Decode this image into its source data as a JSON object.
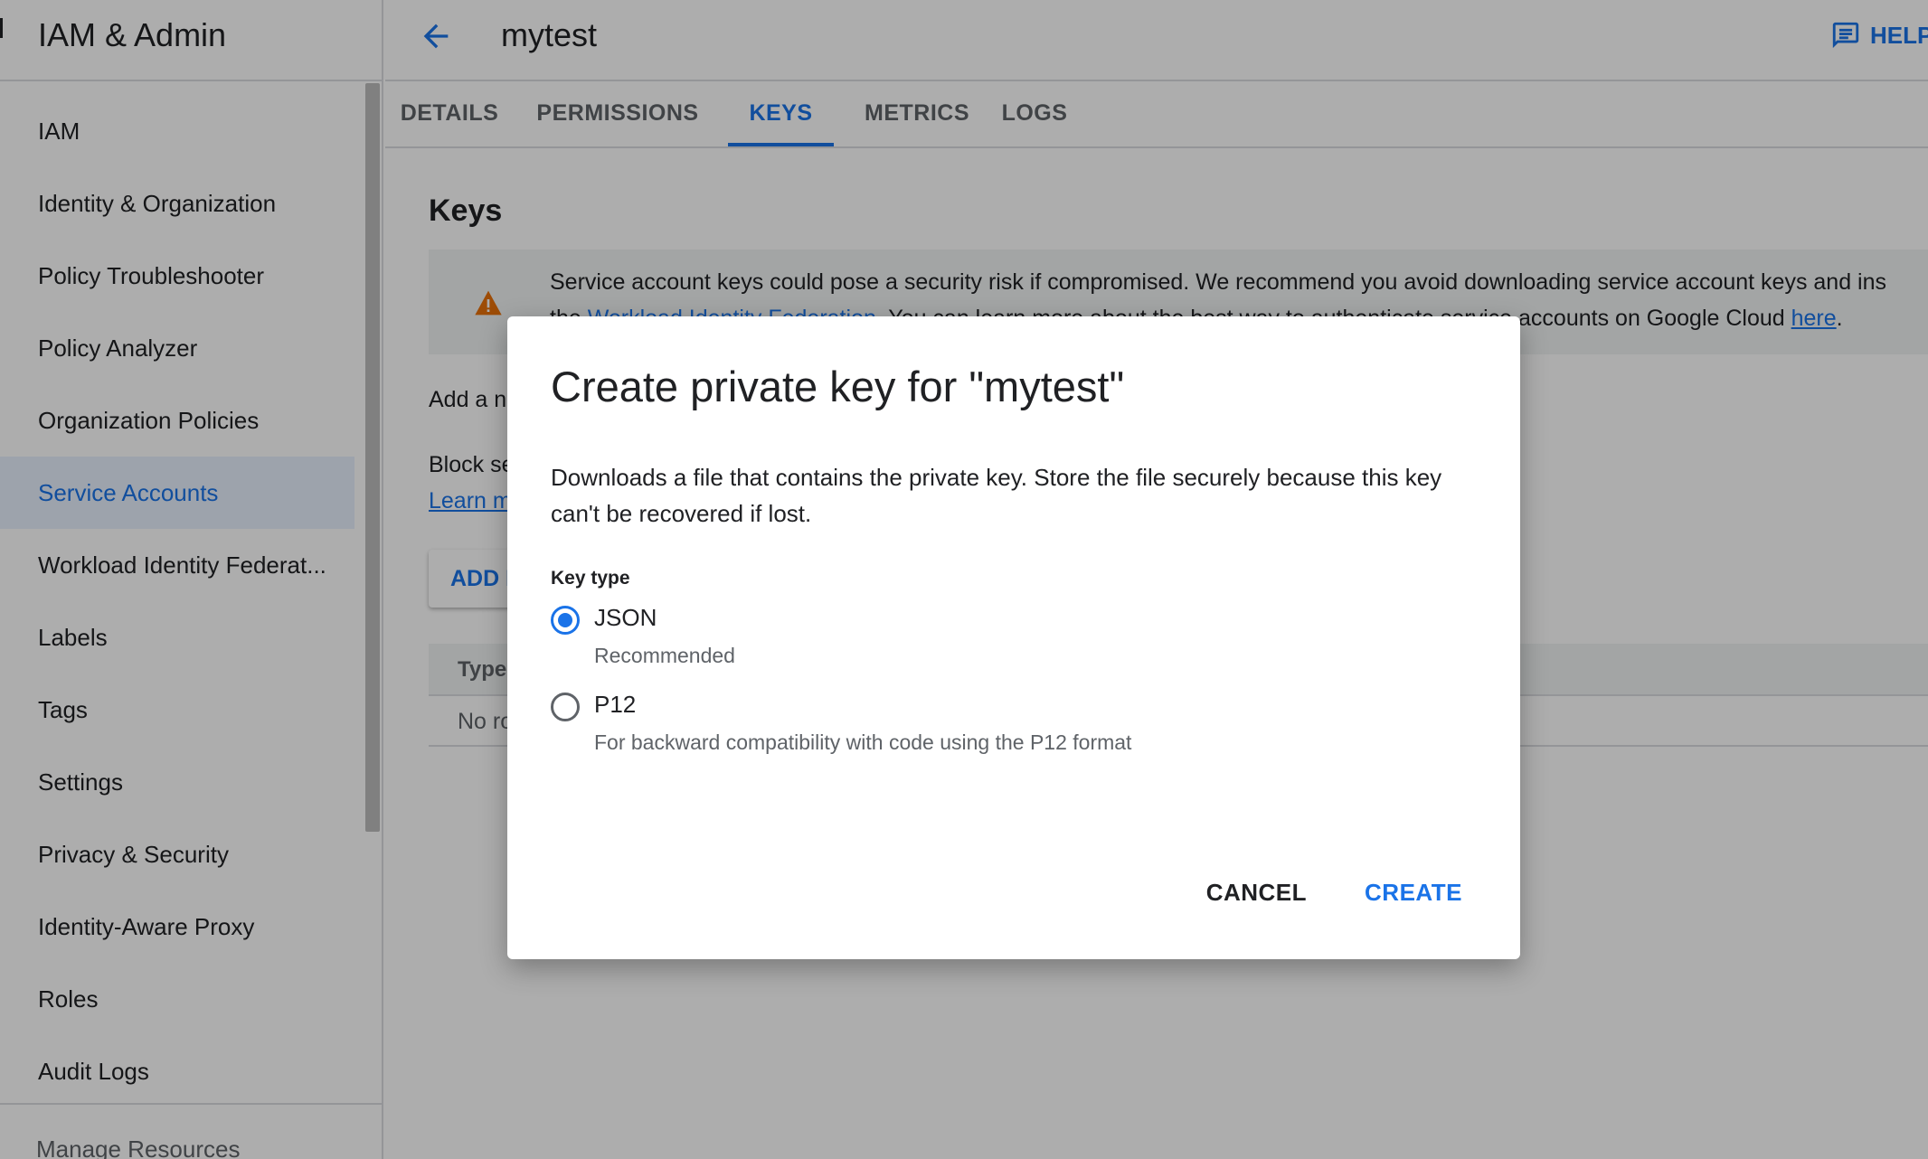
{
  "sidebar": {
    "title": "IAM & Admin",
    "items": [
      {
        "label": "IAM"
      },
      {
        "label": "Identity & Organization"
      },
      {
        "label": "Policy Troubleshooter"
      },
      {
        "label": "Policy Analyzer"
      },
      {
        "label": "Organization Policies"
      },
      {
        "label": "Service Accounts",
        "active": true
      },
      {
        "label": "Workload Identity Federat..."
      },
      {
        "label": "Labels"
      },
      {
        "label": "Tags"
      },
      {
        "label": "Settings"
      },
      {
        "label": "Privacy & Security"
      },
      {
        "label": "Identity-Aware Proxy"
      },
      {
        "label": "Roles"
      },
      {
        "label": "Audit Logs"
      }
    ],
    "footer": "Manage Resources"
  },
  "header": {
    "title": "mytest",
    "help_label": "HELP",
    "back_icon": "arrow-back-icon",
    "help_icon": "feedback-icon"
  },
  "tabs": [
    {
      "label": "DETAILS"
    },
    {
      "label": "PERMISSIONS"
    },
    {
      "label": "KEYS",
      "active": true
    },
    {
      "label": "METRICS"
    },
    {
      "label": "LOGS"
    }
  ],
  "keys_page": {
    "title": "Keys",
    "warning": {
      "icon": "warning-icon",
      "line1": "Service account keys could pose a security risk if compromised. We recommend you avoid downloading service account keys and ins",
      "line2_prefix": "the ",
      "line2_link": "Workload Identity Federation",
      "line2_middle": ". You can learn more about the best way to authenticate service accounts on Google Cloud ",
      "line2_link2": "here",
      "line2_suffix": "."
    },
    "add_text": "Add a n",
    "block_text": "Block se",
    "learn_text": "Learn m",
    "add_key_label": "ADD K",
    "table_header_type": "Type",
    "table_empty": "No ro"
  },
  "dialog": {
    "title": "Create private key for \"mytest\"",
    "description": "Downloads a file that contains the private key. Store the file securely because this key can't be recovered if lost.",
    "key_type_label": "Key type",
    "options": [
      {
        "label": "JSON",
        "sublabel": "Recommended",
        "checked": true
      },
      {
        "label": "P12",
        "sublabel": "For backward compatibility with code using the P12 format",
        "checked": false
      }
    ],
    "cancel_label": "CANCEL",
    "create_label": "CREATE"
  },
  "colors": {
    "accent": "#1a73e8",
    "warning": "#e8710a"
  }
}
